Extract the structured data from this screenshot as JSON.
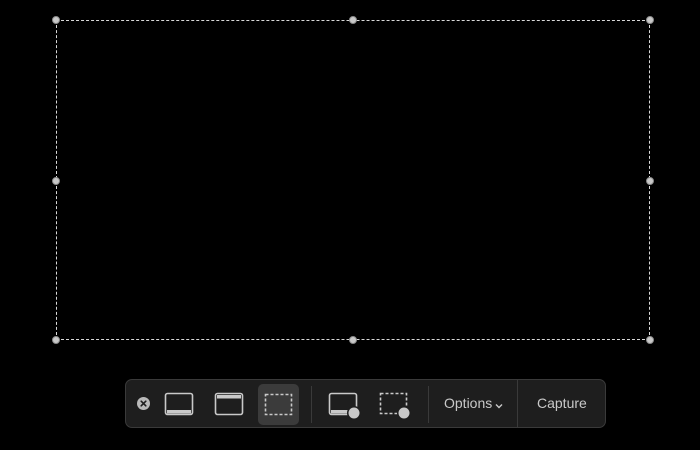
{
  "toolbar": {
    "close_icon": "close-circle-icon",
    "buttons": [
      {
        "name": "capture-entire-screen",
        "icon": "screen-icon",
        "selected": false
      },
      {
        "name": "capture-selected-window",
        "icon": "window-icon",
        "selected": false
      },
      {
        "name": "capture-selected-portion",
        "icon": "dashed-rect-icon",
        "selected": true
      },
      {
        "name": "record-entire-screen",
        "icon": "screen-record-icon",
        "selected": false
      },
      {
        "name": "record-selected-portion",
        "icon": "dashed-rect-record-icon",
        "selected": false
      }
    ],
    "options_label": "Options",
    "options_icon": "chevron-down-icon",
    "capture_label": "Capture"
  },
  "colors": {
    "background": "#000000",
    "toolbar_bg": "#1e1e1e",
    "selected_bg": "#3b3b3b",
    "icon": "#c9c9c9"
  }
}
